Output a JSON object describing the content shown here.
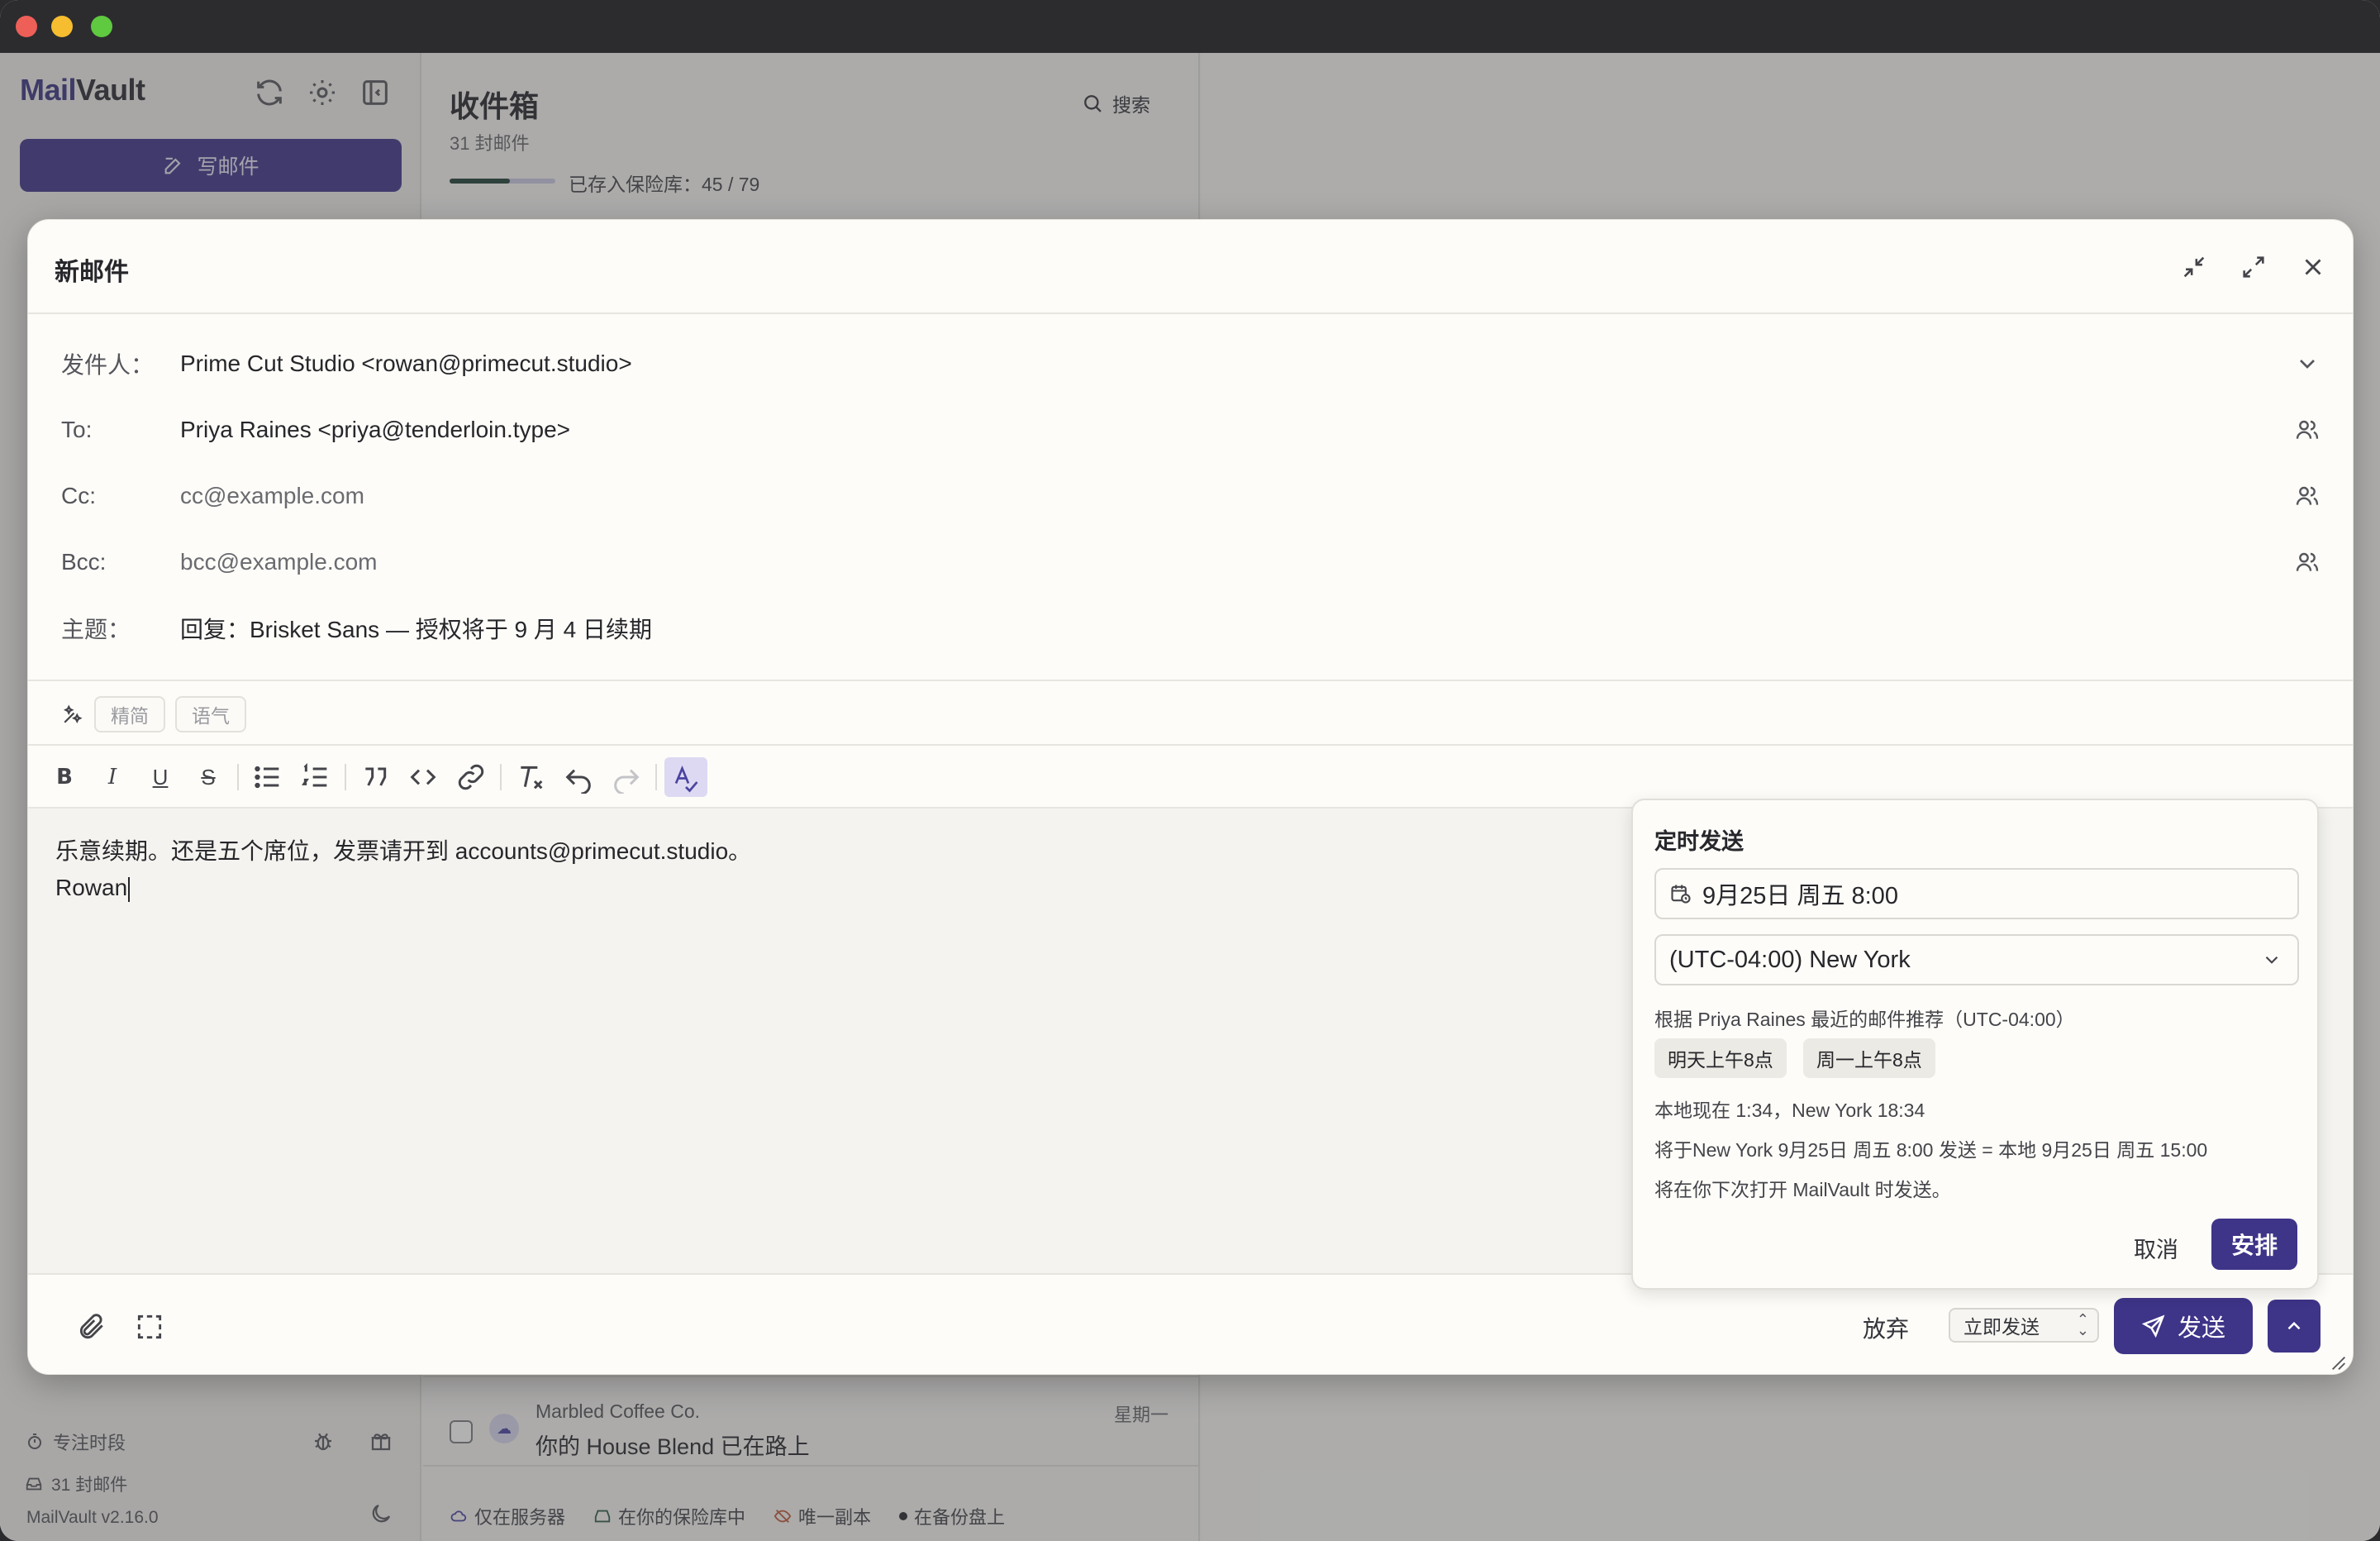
{
  "app": {
    "logo_part1": "Mail",
    "logo_part2": "Vault",
    "compose_label": "写邮件",
    "focus_label": "专注时段",
    "mail_count": "31 封邮件",
    "version": "MailVault v2.16.0"
  },
  "list": {
    "title": "收件箱",
    "count": "31 封邮件",
    "search_label": "搜索",
    "vault_label": "已存入保险库：45 / 79",
    "vault_fraction": 0.57,
    "row": {
      "from": "Marbled Coffee Co.",
      "subject": "你的 House Blend 已在路上",
      "date": "星期一"
    },
    "legend": [
      "仅在服务器",
      "在你的保险库中",
      "唯一副本",
      "在备份盘上"
    ]
  },
  "compose": {
    "title": "新邮件",
    "from_label": "发件人：",
    "from_value": "Prime Cut Studio <rowan@primecut.studio>",
    "to_label": "To:",
    "to_value": "Priya Raines <priya@tenderloin.type>",
    "cc_label": "Cc:",
    "cc_placeholder": "cc@example.com",
    "bcc_label": "Bcc:",
    "bcc_placeholder": "bcc@example.com",
    "subject_label": "主题：",
    "subject_value": "回复：Brisket Sans — 授权将于 9 月 4 日续期",
    "ai_chips": [
      "精简",
      "语气"
    ],
    "body_lines": [
      "乐意续期。还是五个席位，发票请开到 accounts@primecut.studio。",
      "Rowan"
    ],
    "discard_label": "放弃",
    "send_mode": "立即发送",
    "send_label": "发送"
  },
  "schedule": {
    "title": "定时发送",
    "datetime": "9月25日 周五 8:00",
    "timezone": "(UTC-04:00) New York",
    "recommend": "根据 Priya Raines 最近的邮件推荐（UTC-04:00）",
    "chips": [
      "明天上午8点",
      "周一上午8点"
    ],
    "local_now": "本地现在 1:34，New York 18:34",
    "send_at": "将于New York 9月25日 周五 8:00 发送 = 本地 9月25日 周五 15:00",
    "note": "将在你下次打开 MailVault 时发送。",
    "cancel_label": "取消",
    "confirm_label": "安排"
  },
  "colors": {
    "accent": "#3e3488",
    "vault_progress": "#1f3f35"
  }
}
